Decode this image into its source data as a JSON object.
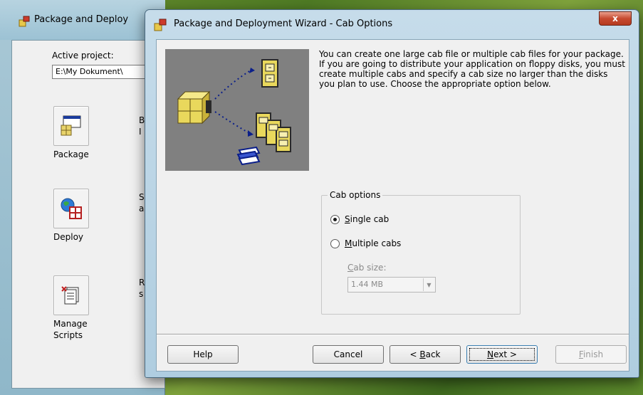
{
  "background_window": {
    "title": "Package and Deploy",
    "active_project_label": "Active project:",
    "active_project_value": "E:\\My Dokument\\",
    "tools": [
      {
        "label": "Package",
        "desc": "B\nI"
      },
      {
        "label": "Deploy",
        "desc": "S\na"
      },
      {
        "label": "Manage\nScripts",
        "desc": "R\ns"
      }
    ]
  },
  "dialog": {
    "title": "Package and Deployment Wizard - Cab Options",
    "close_label": "x",
    "description": "You can create one large cab file or multiple cab files for your package. If you are going to distribute your application on floppy disks, you must create multiple cabs and specify a cab size no larger than the disks you plan to use. Choose the appropriate option below.",
    "cab_options": {
      "legend": "Cab options",
      "single_cab": {
        "label": "Single cab",
        "checked": true
      },
      "multiple_cabs": {
        "label": "Multiple cabs",
        "checked": false
      },
      "cab_size_label": "Cab size:",
      "cab_size_value": "1.44 MB"
    },
    "buttons": {
      "help": "Help",
      "cancel": "Cancel",
      "back": "< Back",
      "next": "Next >",
      "finish": "Finish"
    }
  },
  "colors": {
    "dialog_frame": "#afcde0",
    "close_button": "#c74a30",
    "client_bg": "#f0f0f0",
    "wizard_image_bg": "#808080"
  }
}
